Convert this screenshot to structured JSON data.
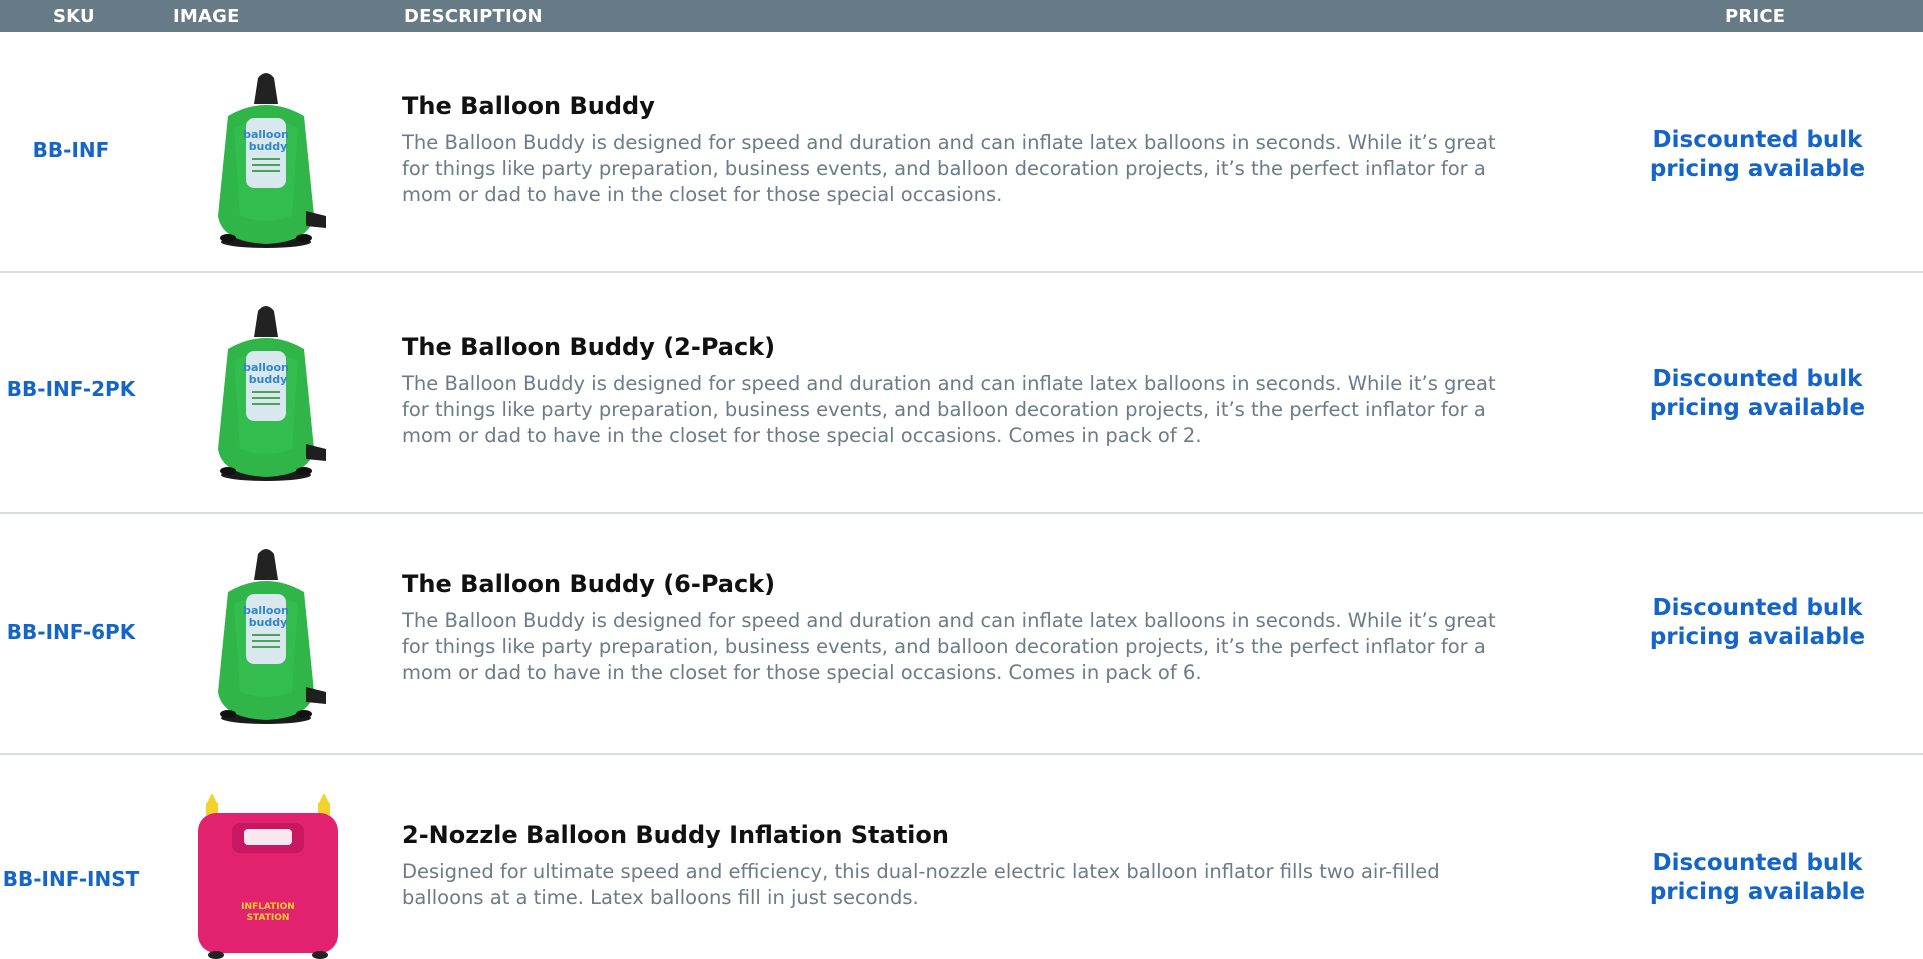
{
  "header": {
    "sku": "SKU",
    "image": "IMAGE",
    "description": "DESCRIPTION",
    "price": "PRICE"
  },
  "rows": [
    {
      "sku": "BB-INF",
      "image_icon": "green-balloon-pump-image",
      "title": "The Balloon Buddy",
      "description": "The Balloon Buddy is designed for speed and duration and can inflate latex balloons in seconds. While it’s great for things like party preparation, business events, and balloon decoration projects, it’s the perfect inflator for a mom or dad to have in the closet for those special occasions.",
      "price": "Discounted bulk pricing available"
    },
    {
      "sku": "BB-INF-2PK",
      "image_icon": "green-balloon-pump-image",
      "title": "The Balloon Buddy (2-Pack)",
      "description": "The Balloon Buddy is designed for speed and duration and can inflate latex balloons in seconds. While it’s great for things like party preparation, business events, and balloon decoration projects, it’s the perfect inflator for a mom or dad to have in the closet for those special occasions. Comes in pack of 2.",
      "price": "Discounted bulk pricing available"
    },
    {
      "sku": "BB-INF-6PK",
      "image_icon": "green-balloon-pump-image",
      "title": "The Balloon Buddy (6-Pack)",
      "description": "The Balloon Buddy is designed for speed and duration and can inflate latex balloons in seconds. While it’s great for things like party preparation, business events, and balloon decoration projects, it’s the perfect inflator for a mom or dad to have in the closet for those special occasions. Comes in pack of 6.",
      "price": "Discounted bulk pricing available"
    },
    {
      "sku": "BB-INF-INST",
      "image_icon": "pink-inflation-station-image",
      "title": "2-Nozzle Balloon Buddy Inflation Station",
      "description": "Designed for ultimate speed and efficiency, this dual-nozzle electric latex balloon inflator fills two air-filled balloons at a time. Latex balloons fill in just seconds.",
      "price": "Discounted bulk pricing available"
    }
  ],
  "colors": {
    "header_bg": "#667b85",
    "accent_blue": "#1565c8",
    "body_text": "#6b7b88",
    "pump_green": "#2fb548",
    "station_pink": "#e3226f"
  }
}
